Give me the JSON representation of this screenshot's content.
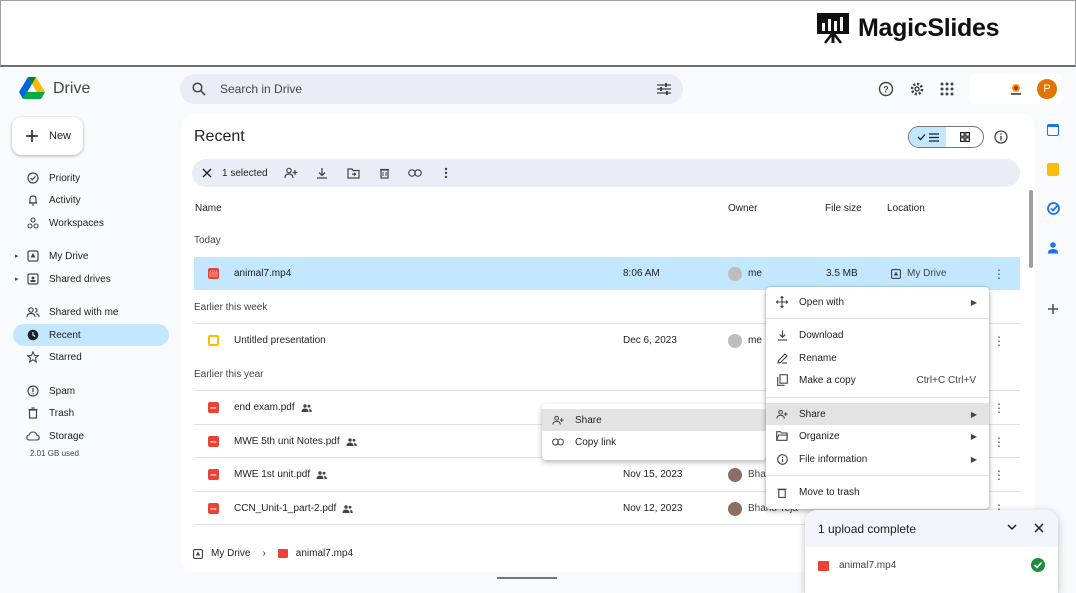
{
  "banner": {
    "brand": "MagicSlides"
  },
  "drive": {
    "product": "Drive"
  },
  "search": {
    "placeholder": "Search in Drive"
  },
  "profile": {
    "initial": "P"
  },
  "new_button": {
    "label": "New"
  },
  "sidebar": {
    "items": [
      {
        "label": "Priority"
      },
      {
        "label": "Activity"
      },
      {
        "label": "Workspaces"
      },
      {
        "label": "My Drive"
      },
      {
        "label": "Shared drives"
      },
      {
        "label": "Shared with me"
      },
      {
        "label": "Recent"
      },
      {
        "label": "Starred"
      },
      {
        "label": "Spam"
      },
      {
        "label": "Trash"
      },
      {
        "label": "Storage"
      }
    ],
    "storage_used": "2.01 GB used"
  },
  "page": {
    "title": "Recent"
  },
  "selection": {
    "count_label": "1 selected"
  },
  "columns": {
    "name": "Name",
    "owner": "Owner",
    "size": "File size",
    "location": "Location"
  },
  "sections": {
    "today": "Today",
    "this_week": "Earlier this week",
    "this_year": "Earlier this year"
  },
  "files": [
    {
      "name": "animal7.mp4",
      "date": "8:06 AM",
      "owner": "me",
      "size": "3.5 MB",
      "location": "My Drive"
    },
    {
      "name": "Untitled presentation",
      "date": "Dec 6, 2023",
      "owner": "me"
    },
    {
      "name": "end exam.pdf"
    },
    {
      "name": "MWE 5th unit Notes.pdf"
    },
    {
      "name": "MWE 1st unit.pdf",
      "date": "Nov 15, 2023",
      "owner": "Bha"
    },
    {
      "name": "CCN_Unit-1_part-2.pdf",
      "date": "Nov 12, 2023",
      "owner": "Bhanu Teja"
    }
  ],
  "context_menu": {
    "open_with": "Open with",
    "download": "Download",
    "rename": "Rename",
    "make_copy": "Make a copy",
    "make_copy_shortcut": "Ctrl+C Ctrl+V",
    "share": "Share",
    "organize": "Organize",
    "file_information": "File information",
    "move_to_trash": "Move to trash"
  },
  "share_submenu": {
    "share": "Share",
    "copy_link": "Copy link"
  },
  "upload": {
    "title": "1 upload complete",
    "file": "animal7.mp4"
  },
  "breadcrumb": {
    "root": "My Drive",
    "file": "animal7.mp4"
  },
  "colors": {
    "accent": "#c2e7ff",
    "brand_blue": "#0b57d0",
    "profile": "#e37400",
    "pdf_red": "#ea4335",
    "success": "#1e8e3e"
  }
}
